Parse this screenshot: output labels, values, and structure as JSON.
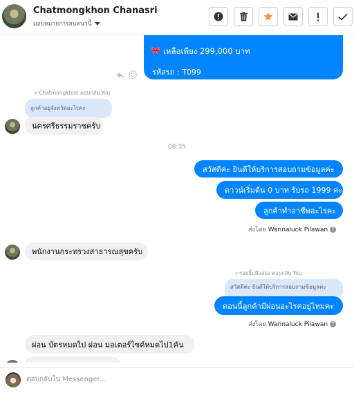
{
  "header": {
    "contact_name": "Chatmongkhon Chanasri",
    "assigned_label": "มอบหมายการสนทนานี้",
    "toolbar": {
      "report_icon": "exclamation-circle-icon",
      "delete_icon": "trash-icon",
      "star_icon": "star-icon",
      "mail_icon": "envelope-icon",
      "alert_icon": "exclamation-icon",
      "done_icon": "checkmark-icon"
    },
    "accent_star_color": "#f7923b"
  },
  "messages": {
    "top_price": "เหลือเพียง 299,000 บาท",
    "top_code": "รหัสรถ : T099",
    "reply1_label": "Chatmongkhon ตอบกลับ You",
    "reply1_quote": "ลูกค้าอยู่จังหวัดอะไรคะ",
    "in1_text": "นครศรีธรรมราชครับ",
    "timestamp": "08:35",
    "out1_text": "สวัสดีค่ะ ยินดีให้บริการสอบถามข้อมูลค่ะ",
    "out2_text": "ดาวน์เริ่มต้น 0 บาท รับรถ 1999 ค่ะ",
    "out3_text": "ลูกค้าทำอาชีพอะไรคะ",
    "sent_by_prefix": "ส่งโดย",
    "sent_by_name": "Wannaluck Pilawan",
    "in2_text": "พนักงานกระทรวงสาธารณสุขครับ",
    "reply2_label": "รอยยิ้มมือสอง ตอบกลับ You",
    "reply2_quote": "สวัสดีค่ะ ยินดีให้บริการสอบถามข้อมูลค่ะ",
    "out4_text": "ตอนนี้ลูกค้ามีผ่อนอะไรคอยู่ไหมคะ",
    "in3_text": "ผ่อน บัตรหมดไป ผ่อน มอเตอร์ไซค์หมดไป1คัน"
  },
  "composer": {
    "placeholder": "ตอบกลับใน Messenger..."
  }
}
